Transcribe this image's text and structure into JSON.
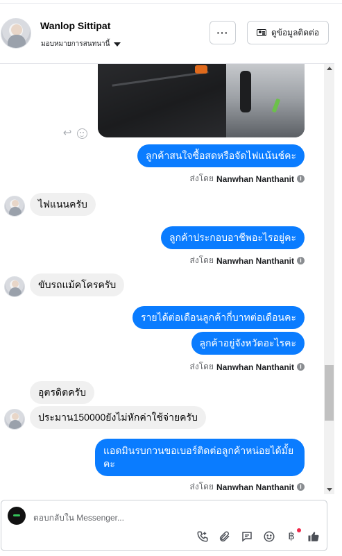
{
  "header": {
    "contact_name": "Wanlop Sittipat",
    "assign_label": "มอบหมายการสนทนานี้",
    "more_label": "···",
    "contact_info_label": "ดูข้อมูลติดต่อ"
  },
  "messages": [
    {
      "id": "m1",
      "direction": "out",
      "text": "ลูกค้าสนใจซื้อสดหรือจัดไฟแน้นช์คะ",
      "sent_by_prefix": "ส่งโดย",
      "sent_by_name": "Nanwhan Nanthanit"
    },
    {
      "id": "m2",
      "direction": "in",
      "text": "ไฟแนนครับ"
    },
    {
      "id": "m3",
      "direction": "out",
      "text": "ลูกค้าประกอบอาชีพอะไรอยู่คะ",
      "sent_by_prefix": "ส่งโดย",
      "sent_by_name": "Nanwhan Nanthanit"
    },
    {
      "id": "m4",
      "direction": "in",
      "text": "ขับรถแม้คโครครับ"
    },
    {
      "id": "m5",
      "direction": "out",
      "text": "รายได้ต่อเดือนลูกค้ากี่บาทต่อเดือนคะ"
    },
    {
      "id": "m6",
      "direction": "out",
      "text": "ลูกค้าอยู่จังหวัดอะไรคะ",
      "sent_by_prefix": "ส่งโดย",
      "sent_by_name": "Nanwhan Nanthanit"
    },
    {
      "id": "m7",
      "direction": "in",
      "text": "อุตรดิตครับ"
    },
    {
      "id": "m8",
      "direction": "in",
      "text": "ประมาน150000ยังไม่หักค่าใช้จ่ายครับ"
    },
    {
      "id": "m9",
      "direction": "out",
      "text_line1": "แอดมินรบกวนขอเบอร์ติดต่อลูกค้าหน่อยได้มั้ย",
      "text_line2": "คะ",
      "sent_by_prefix": "ส่งโดย",
      "sent_by_name": "Nanwhan Nanthanit"
    }
  ],
  "info_icon": "i",
  "composer": {
    "placeholder": "ตอบกลับใน Messenger...",
    "tools": [
      "call-icon",
      "attach-icon",
      "saved-replies-icon",
      "emoji-icon",
      "payment-icon",
      "like-icon"
    ],
    "payment_symbol": "฿"
  },
  "colors": {
    "outgoing_bubble": "#0a7cff",
    "incoming_bubble": "#f0f0f0",
    "notification_dot": "#f02849"
  }
}
